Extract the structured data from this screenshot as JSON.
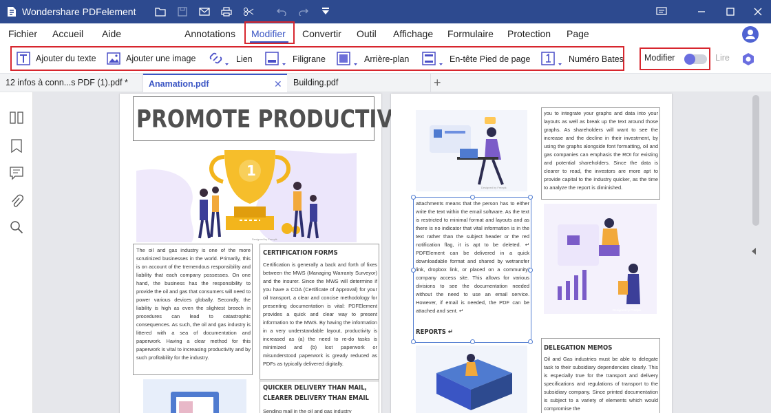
{
  "titlebar": {
    "app_title": "Wondershare PDFelement"
  },
  "menu": {
    "fichier": "Fichier",
    "accueil": "Accueil",
    "aide": "Aide",
    "annotations": "Annotations",
    "modifier": "Modifier",
    "convertir": "Convertir",
    "outil": "Outil",
    "affichage": "Affichage",
    "formulaire": "Formulaire",
    "protection": "Protection",
    "page": "Page"
  },
  "toolbar": {
    "add_text": "Ajouter du texte",
    "add_image": "Ajouter une image",
    "link": "Lien",
    "watermark": "Filigrane",
    "background": "Arrière-plan",
    "header_footer": "En-tête  Pied de page",
    "bates": "Numéro Bates",
    "mode_edit": "Modifier",
    "mode_read": "Lire"
  },
  "tabs": [
    {
      "label": "12 infos à conn...s PDF (1).pdf *"
    },
    {
      "label": "Anamation.pdf"
    },
    {
      "label": "Building.pdf"
    }
  ],
  "doc": {
    "title": "PROMOTE PRODUCTIVITY",
    "trophy_number": "1",
    "designed_by": "Designed by Freepik",
    "col1": "The oil and gas industry is one of the more scrutinized businesses in the world. Primarily, this is on account of the tremendous responsibility and liability that each company possesses. On one hand, the business has the responsibility to provide the oil and gas that consumers will need to power various devices globally. Secondly, the liability is high as even the slightest breech in procedures can lead to catastrophic consequences. As such, the oil and gas industry is littered with a sea of documentation and paperwork. Having a clear method for this paperwork is vital to increasing productivity and by such profitability for the industry.",
    "cert_head": "CERTIFICATION FORMS",
    "cert_text": "Certification is generally a back and forth of fixes between the MWS (Managing Warranty Surveyor) and the insurer. Since the MWS will determine if you have a COA (Certificate of Approval) for your oil transport, a clear and concise methodology for presenting documentation is vital: PDFElement provides a quick and clear way to present information to the MWS. By having the information in a very understandable layout, productivity is increased as (a) the need to re-do tasks is minimized and (b) lost paperwork or misunderstood paperwork is greatly reduced as PDFs as typically delivered digitally.",
    "quick_head": "QUICKER DELIVERY THAN MAIL, CLEARER DELIVERY THAN EMAIL",
    "quick_text": "Sending mail in the oil and gas industry",
    "p2_top": "you to integrate your graphs and data into your layouts as well as break up the text around those graphs. As shareholders will want to see the increase and the decline in their investment, by using the graphs alongside font formatting, oil and gas companies can emphasis the ROI for existing and potential shareholders. Since the data is clearer to read, the investors are more apt to provide capital to the industry quicker, as the time to analyze the report is diminished.",
    "p2_mid": "attachments means that the person has to either write the text within the email software. As the text is restricted to minimal format and layouts and as there is no indicator that vital information is in the text rather than the subject header or the red notification flag, it is apt to be deleted. ↵ PDFElement can be delivered in a quick downloadable format and shared by wetransfer link, dropbox link, or placed on a community/ company access site. This allows for various divisions to see the documentation needed without the need to use an email service. However, if email is needed, the PDF can be attached and sent. ↵",
    "reports_head": "REPORTS ↵",
    "deleg_head": "DELEGATION MEMOS",
    "deleg_text": "Oil and Gas industries must be able to delegate task to their subsidiary dependencies clearly. This is especially true for the transport and delivery specifications and regulations of transport to the subsidiary company. Since printed documentation is subject to a variety of elements which would compromise the"
  },
  "colors": {
    "titlebar": "#2d4a8f",
    "accent": "#4f63d2",
    "highlight": "#d7262e",
    "purple": "#7b5cc8",
    "gold": "#f3b51c"
  }
}
